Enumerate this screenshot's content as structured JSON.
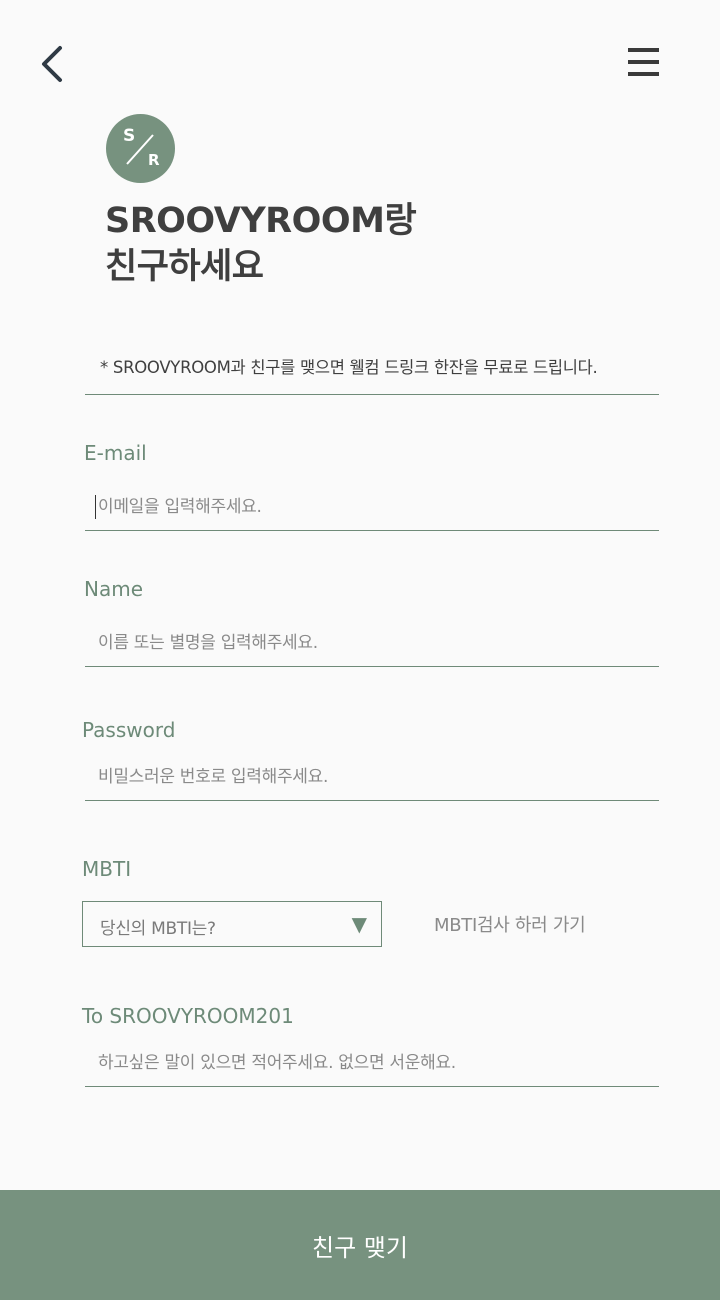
{
  "header": {
    "back_icon": "chevron-left-icon",
    "menu_icon": "hamburger-menu-icon"
  },
  "logo": {
    "top_letter": "S",
    "bottom_letter": "R"
  },
  "title": {
    "line1": "SROOVYROOM랑",
    "line2": "친구하세요"
  },
  "notice": "* SROOVYROOM과 친구를 맺으면 웰컴 드링크 한잔을 무료로 드립니다.",
  "fields": {
    "email": {
      "label": "E-mail",
      "placeholder": "이메일을 입력해주세요.",
      "value": ""
    },
    "name": {
      "label": "Name",
      "placeholder": "이름 또는 별명을 입력해주세요.",
      "value": ""
    },
    "password": {
      "label": "Password",
      "placeholder": "비밀스러운 번호로 입력해주세요.",
      "value": ""
    },
    "mbti": {
      "label": "MBTI",
      "selected": "당신의 MBTI는?",
      "arrow": "▼",
      "link": "MBTI검사 하러 가기"
    },
    "message": {
      "label": "To SROOVYROOM201",
      "placeholder": "하고싶은 말이 있으면 적어주세요. 없으면 서운해요.",
      "value": ""
    }
  },
  "submit_label": "친구 맺기",
  "colors": {
    "accent": "#77927f",
    "background": "#fafafa",
    "text": "#3d3d3d"
  }
}
